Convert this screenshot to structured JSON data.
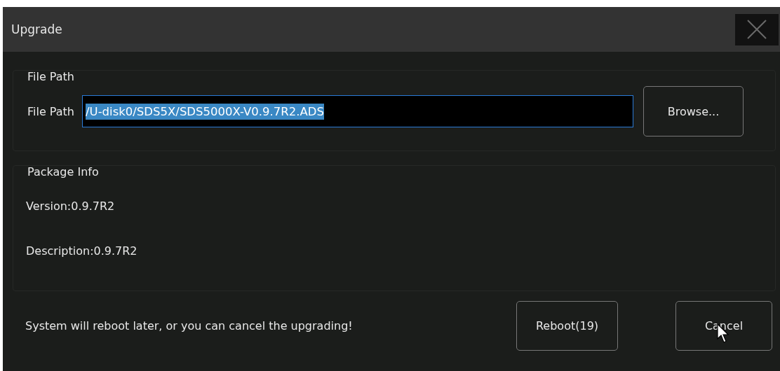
{
  "window": {
    "title": "Upgrade"
  },
  "file_group": {
    "title": "File Path",
    "label": "File Path",
    "value": "/U-disk0/SDS5X/SDS5000X-V0.9.7R2.ADS",
    "text_selected": true,
    "browse": "Browse..."
  },
  "package_group": {
    "title": "Package Info",
    "lines": [
      "Version:0.9.7R2",
      "Description:0.9.7R2"
    ]
  },
  "footer": {
    "message": "System will reboot later, or you can cancel the upgrading!",
    "buttons": [
      "Reboot(19)",
      "Cancel"
    ]
  }
}
